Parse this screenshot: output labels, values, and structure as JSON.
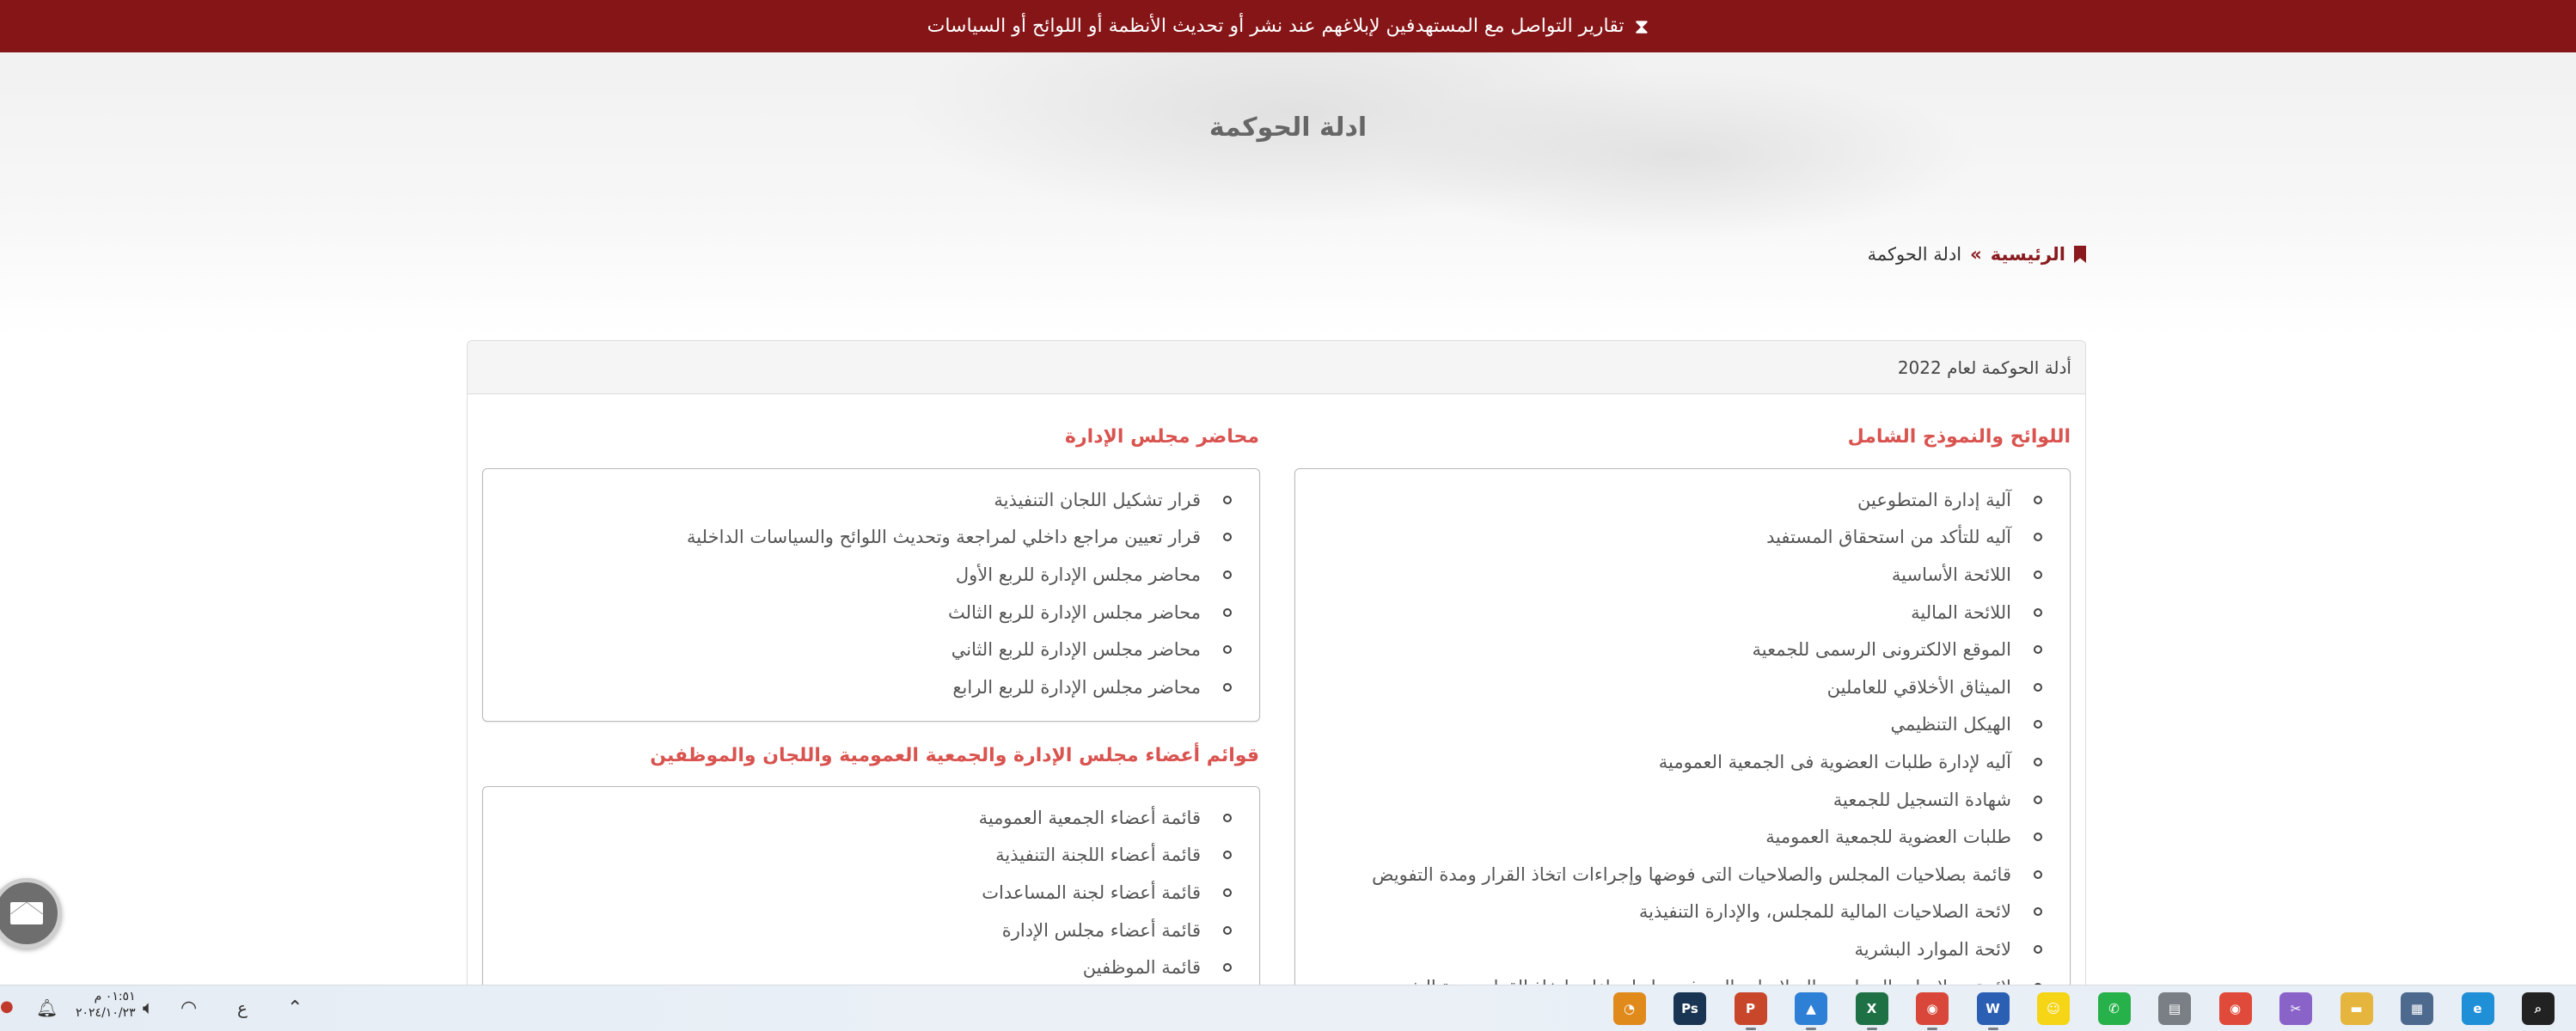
{
  "banner": {
    "icon": "hourglass-icon",
    "text": "تقارير التواصل مع المستهدفين لإبلاغهم عند نشر أو تحديث الأنظمة أو اللوائح أو السياسات"
  },
  "page": {
    "title": "ادلة الحوكمة"
  },
  "breadcrumb": {
    "home": "الرئيسية",
    "separator": "»",
    "current": "ادلة الحوكمة"
  },
  "panel": {
    "heading": "أدلة الحوكمة لعام 2022"
  },
  "right_column": {
    "title": "اللوائح والنموذج الشامل",
    "items": [
      "آلية إدارة المتطوعين",
      "آليه للتأكد من استحقاق المستفيد",
      "اللائحة الأساسية",
      "اللائحة المالية",
      "الموقع الالكترونى الرسمى للجمعية",
      "الميثاق الأخلاقي للعاملين",
      "الهيكل التنظيمي",
      "آليه لإدارة طلبات العضوية فى الجمعية العمومية",
      "شهادة التسجيل للجمعية",
      "طلبات العضوية للجمعية العمومية",
      "قائمة بصلاحيات المجلس والصلاحيات التى فوضها وإجراءات اتخاذ القرار ومدة التفويض",
      "لائحة الصلاحيات المالية للمجلس، والإدارة التنفيذية",
      "لائحة الموارد البشرية",
      "لائحة بصلاحيات المجلس والصلاحيات التي فوضها واجراءات اتخاذ القرار ومدة التفويض"
    ]
  },
  "left_column": {
    "minutes_title": "محاضر مجلس الإدارة",
    "minutes_items": [
      "قرار تشكيل اللجان التنفيذية",
      "قرار تعيين مراجع داخلي لمراجعة وتحديث اللوائح والسياسات الداخلية",
      "محاضر مجلس الإدارة للربع الأول",
      "محاضر مجلس الإدارة للربع الثالث",
      "محاضر مجلس الإدارة للربع الثاني",
      "محاضر مجلس الإدارة للربع الرابع"
    ],
    "lists_title": "قوائم أعضاء مجلس الإدارة والجمعية العمومية واللجان والموظفين",
    "lists_items": [
      "قائمة أعضاء الجمعية العمومية",
      "قائمة أعضاء اللجنة التنفيذية",
      "قائمة أعضاء لجنة المساعدات",
      "قائمة أعضاء مجلس الإدارة",
      "قائمة الموظفين"
    ]
  },
  "mail_button": {
    "icon": "envelope-icon"
  },
  "taskbar": {
    "clock_time": "٠١:٥١ م",
    "clock_date": "٢٠٢٤/١٠/٢٣",
    "language": "ع",
    "apps": [
      {
        "icon": "search-icon",
        "color": "#222222",
        "label": "⌕"
      },
      {
        "icon": "edge-icon",
        "color": "#1f8fd8",
        "label": "e"
      },
      {
        "icon": "calculator-icon",
        "color": "#4d6a8e",
        "label": "▦"
      },
      {
        "icon": "file-explorer-icon",
        "color": "#e6b53d",
        "label": "▬"
      },
      {
        "icon": "snipping-tool-icon",
        "color": "#8a63c9",
        "label": "✂"
      },
      {
        "icon": "chrome-icon",
        "color": "#e04a3a",
        "label": "◉"
      },
      {
        "icon": "printer-icon",
        "color": "#7a7f86",
        "label": "▤"
      },
      {
        "icon": "whatsapp-icon",
        "color": "#27b14a",
        "label": "✆"
      },
      {
        "icon": "snapchat-icon",
        "color": "#f5d515",
        "label": "☺"
      },
      {
        "icon": "word-icon",
        "color": "#2b5fb3",
        "label": "W"
      },
      {
        "icon": "chrome-profile-icon",
        "color": "#d9473a",
        "label": "◉"
      },
      {
        "icon": "excel-icon",
        "color": "#1e7145",
        "label": "X"
      },
      {
        "icon": "photos-icon",
        "color": "#2e7fd6",
        "label": "▲"
      },
      {
        "icon": "powerpoint-icon",
        "color": "#c8472b",
        "label": "P"
      },
      {
        "icon": "photoshop-icon",
        "color": "#1a3553",
        "label": "Ps"
      },
      {
        "icon": "magnifier-icon",
        "color": "#e08a1c",
        "label": "◔"
      }
    ]
  }
}
